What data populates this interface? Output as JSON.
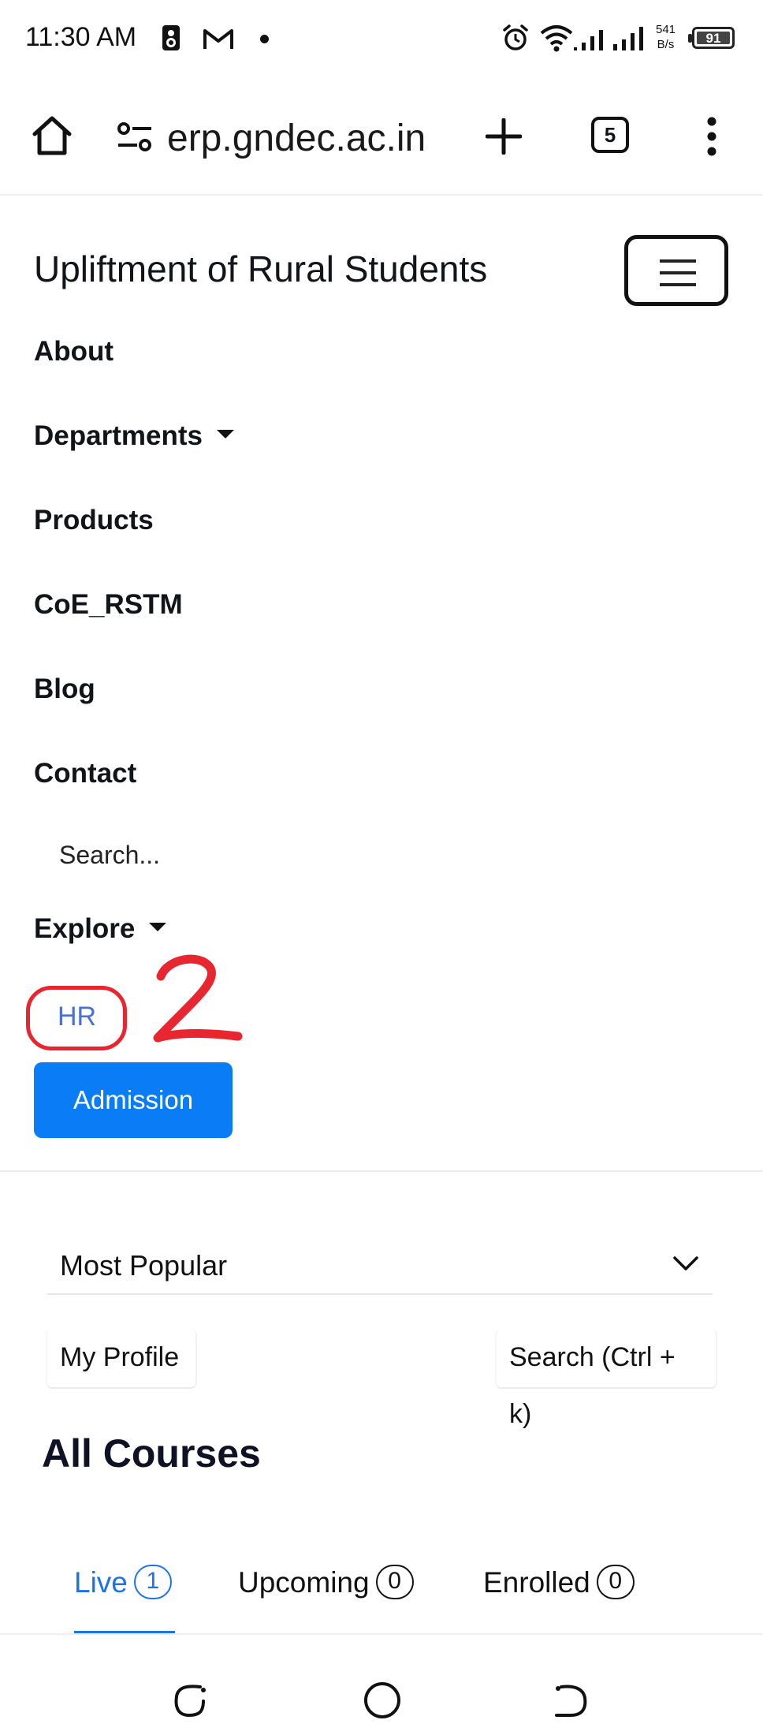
{
  "status_bar": {
    "time": "11:30 AM",
    "speed_value": "541",
    "speed_unit": "B/s",
    "battery": "91",
    "icons": [
      "speaker-icon",
      "gmail-icon",
      "dot-icon",
      "alarm-icon",
      "wifi-icon",
      "signal-icon",
      "signal-icon",
      "battery-icon"
    ]
  },
  "browser": {
    "url": "erp.gndec.ac.in",
    "tab_count": "5",
    "icons": [
      "home-icon",
      "site-settings-icon",
      "new-tab-icon",
      "tab-switcher-icon",
      "more-menu-icon"
    ]
  },
  "navbar": {
    "brand": "Upliftment of Rural Students",
    "items": [
      {
        "label": "About"
      },
      {
        "label": "Departments",
        "dropdown": true
      },
      {
        "label": "Products"
      },
      {
        "label": "CoE_RSTM"
      },
      {
        "label": "Blog"
      },
      {
        "label": "Contact"
      }
    ],
    "search_placeholder": "Search...",
    "explore_label": "Explore",
    "hr_label": "HR",
    "admission_label": "Admission",
    "annotation_mark": "2"
  },
  "filters": {
    "sort_selected": "Most Popular",
    "my_profile": "My Profile",
    "search_shortcut": "Search (Ctrl + k)"
  },
  "courses": {
    "heading": "All Courses",
    "tabs": [
      {
        "label": "Live",
        "count": "1",
        "active": true
      },
      {
        "label": "Upcoming",
        "count": "0",
        "active": false
      },
      {
        "label": "Enrolled",
        "count": "0",
        "active": false
      }
    ]
  },
  "colors": {
    "primary_button": "#0a7df6",
    "link": "#4a6fd8",
    "annotation": "#e8262f",
    "active_tab": "#1a73e8"
  }
}
